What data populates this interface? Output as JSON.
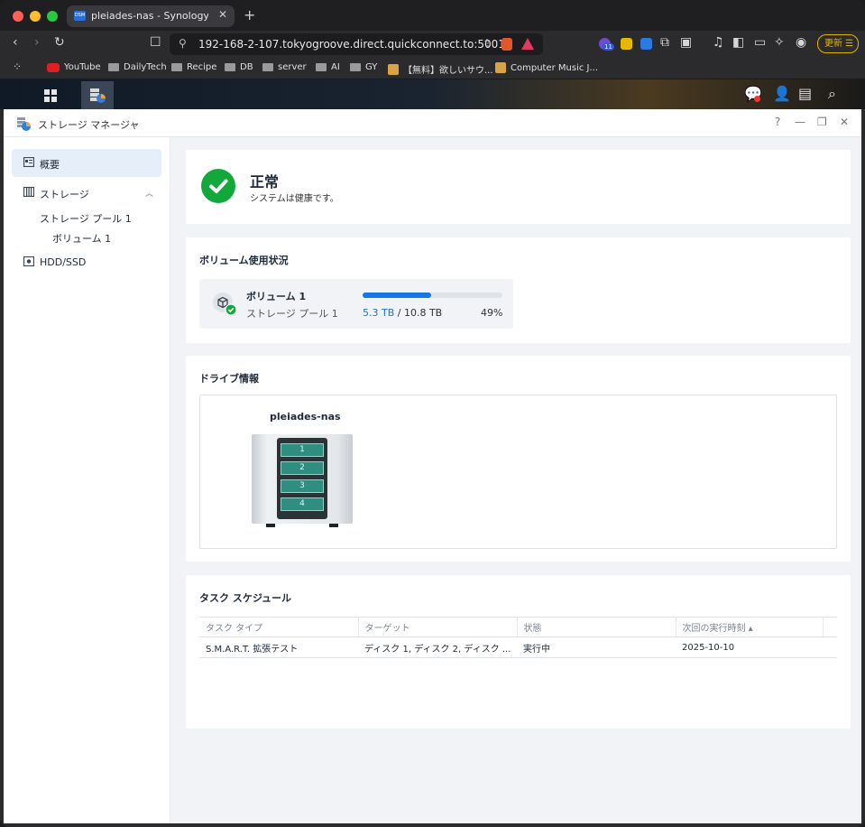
{
  "browser": {
    "tab_title": "pleiades-nas - Synology DiskS",
    "tab_favicon": "DSM",
    "url": "192-168-2-107.tokyogroove.direct.quickconnect.to:5001",
    "extension_badge": "11",
    "update_label": "更新",
    "bookmarks": [
      {
        "label": "YouTube",
        "icon": "youtube-icon"
      },
      {
        "label": "DailyTech",
        "icon": "folder-icon"
      },
      {
        "label": "Recipe",
        "icon": "folder-icon"
      },
      {
        "label": "DB",
        "icon": "folder-icon"
      },
      {
        "label": "server",
        "icon": "folder-icon"
      },
      {
        "label": "AI",
        "icon": "folder-icon"
      },
      {
        "label": "GY",
        "icon": "folder-icon"
      },
      {
        "label": "【無料】欲しいサウ...",
        "icon": "image-icon"
      },
      {
        "label": "Computer Music J...",
        "icon": "image-icon"
      }
    ]
  },
  "app": {
    "title": "ストレージ マネージャ",
    "help": "?"
  },
  "sidebar": {
    "overview": "概要",
    "storage": "ストレージ",
    "storage_pool": "ストレージ プール 1",
    "volume": "ボリューム 1",
    "hdd": "HDD/SSD"
  },
  "status": {
    "title": "正常",
    "description": "システムは健康です。",
    "color": "#12a83a"
  },
  "volume_usage": {
    "section_title": "ボリューム使用状況",
    "name": "ボリューム 1",
    "pool": "ストレージ プール 1",
    "used": "5.3 TB",
    "separator": " / ",
    "total": "10.8 TB",
    "percent_label": "49%",
    "percent_value": 49,
    "bar_color": "#1577e8"
  },
  "drive_info": {
    "section_title": "ドライブ情報",
    "nas_name": "pleiades-nas",
    "bays": [
      "1",
      "2",
      "3",
      "4"
    ]
  },
  "task_schedule": {
    "section_title": "タスク スケジュール",
    "columns": [
      "タスク タイプ",
      "ターゲット",
      "状態",
      "次回の実行時刻 ▴"
    ],
    "rows": [
      {
        "type": "S.M.A.R.T. 拡張テスト",
        "target": "ディスク 1, ディスク 2, ディスク ...",
        "status": "実行中",
        "next": "2025-10-10"
      }
    ]
  }
}
